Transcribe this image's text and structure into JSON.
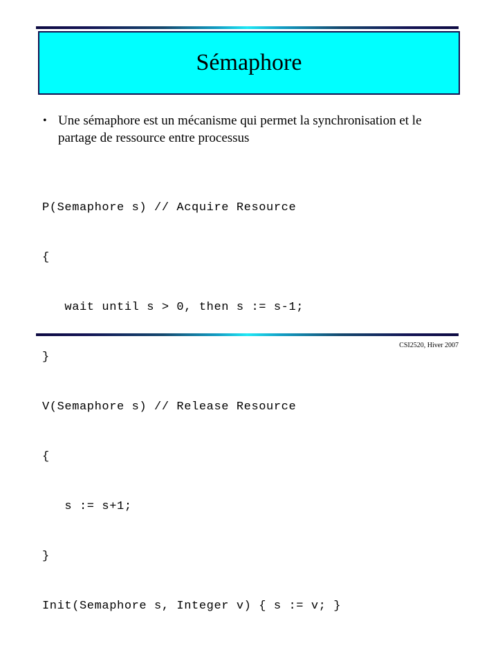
{
  "slide": {
    "title": "Sémaphore",
    "title_box_fill": "#00ffff",
    "title_box_border": "#11114f",
    "accent_dark": "#0d0a42",
    "accent_bright": "#1fe8f5",
    "background": "#ffffff"
  },
  "bullets": [
    {
      "marker": "•",
      "text": "Une sémaphore est un mécanisme qui permet la synchronisation et le partage de ressource entre processus"
    }
  ],
  "code": {
    "lines": [
      "P(Semaphore s) // Acquire Resource",
      "{",
      "   wait until s > 0, then s := s-1;",
      "}",
      "V(Semaphore s) // Release Resource",
      "{",
      "   s := s+1;",
      "}",
      "Init(Semaphore s, Integer v) { s := v; }"
    ]
  },
  "footer": {
    "text": "CSI2520, Hiver 2007"
  }
}
